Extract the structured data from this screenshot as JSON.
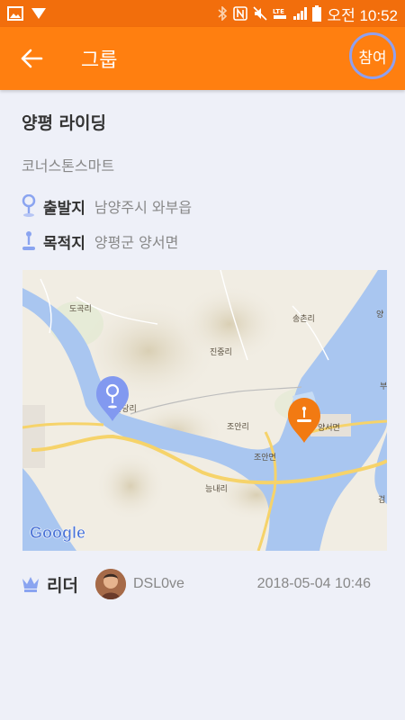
{
  "status_bar": {
    "time": "오전 10:52",
    "icons": [
      "image-icon",
      "signal-arrow-icon",
      "bluetooth-icon",
      "nfc-icon",
      "mute-icon",
      "lte-icon",
      "signal-bars-icon",
      "battery-icon"
    ]
  },
  "app_bar": {
    "title": "그룹",
    "join_label": "참여",
    "colors": {
      "bar": "#ff7f10",
      "status": "#f26e0c",
      "join_ring": "#8fa0f0"
    }
  },
  "group": {
    "name": "양평 라이딩",
    "subtitle": "코너스톤스마트",
    "departure_label": "출발지",
    "departure_value": "남양주시 와부읍",
    "destination_label": "목적지",
    "destination_value": "양평군 양서면"
  },
  "map": {
    "labels": [
      "도곡리",
      "송촌리",
      "진중리",
      "팔당리",
      "조안리",
      "양서면",
      "조안면",
      "능내리",
      "검",
      "양",
      "부"
    ],
    "watermark": "Google"
  },
  "footer": {
    "leader_label": "리더",
    "username": "DSL0ve",
    "timestamp": "2018-05-04 10:46"
  }
}
